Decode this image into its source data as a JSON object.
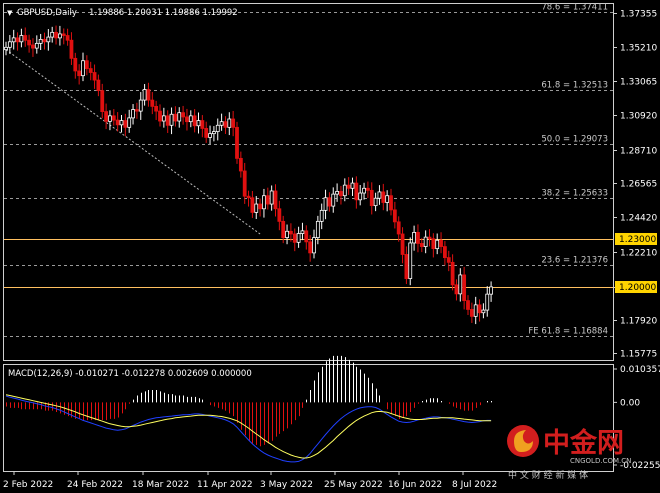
{
  "colors": {
    "background": "#000000",
    "bull_candle": "#ffffff",
    "bear_candle": "#e01010",
    "fib_line": "#9a9a9a",
    "level_line": "#ffc060",
    "level_badge": "#ffd400",
    "macd_hist_pos": "#ffffff",
    "macd_hist_neg": "#e01010",
    "macd_line": "#2040ff",
    "signal_line": "#ffff60",
    "trend_line": "#bdbdbd",
    "watermark_red": "#d21e1e",
    "watermark_orange": "#f0a020"
  },
  "header": {
    "arrow_glyph": "▼",
    "symbol": "GBPUSD,Daily",
    "ohlc": "1.19886 1.20031 1.19886 1.19992"
  },
  "macd_header": "MACD(12,26,9) -0.010271 -0.012278 0.002609 0.000000",
  "watermark": {
    "chinese": "中金网",
    "domain": "CNGOLD.COM.CN",
    "slogan": "中 文 财 经 新 媒 体"
  },
  "chart_data": {
    "type": "candlestick",
    "symbol": "GBPUSD",
    "timeframe": "Daily",
    "ylim": [
      1.1535,
      1.3795
    ],
    "xticks": [
      "2 Feb 2022",
      "24 Feb 2022",
      "18 Mar 2022",
      "11 Apr 2022",
      "3 May 2022",
      "25 May 2022",
      "16 Jun 2022",
      "8 Jul 2022"
    ],
    "price_ticks": [
      "1.37355",
      "1.35210",
      "1.33065",
      "1.30920",
      "1.28710",
      "1.26565",
      "1.24420",
      "1.22210",
      "1.20000",
      "1.17920",
      "1.15775"
    ],
    "fib_levels": [
      {
        "label": "78.6 = 1.37411",
        "value": 1.37411
      },
      {
        "label": "61.8 = 1.32513",
        "value": 1.32513
      },
      {
        "label": "50.0 = 1.29073",
        "value": 1.29073
      },
      {
        "label": "38.2 = 1.25633",
        "value": 1.25633
      },
      {
        "label": "23.6 = 1.21376",
        "value": 1.21376
      },
      {
        "label": "FE 61.8 = 1.16884",
        "value": 1.16884
      }
    ],
    "levels": [
      {
        "label": "1.23000",
        "value": 1.23
      },
      {
        "label": "1.20000",
        "value": 1.2
      }
    ],
    "trendline": {
      "from": {
        "date": "2 Feb 2022",
        "price": 1.3505
      },
      "to": {
        "date": "9 May 2022",
        "price": 1.2335
      }
    },
    "close": [
      1.352,
      1.3555,
      1.358,
      1.3555,
      1.3595,
      1.3565,
      1.3535,
      1.3515,
      1.3545,
      1.357,
      1.3555,
      1.3585,
      1.3615,
      1.358,
      1.3605,
      1.3595,
      1.3565,
      1.345,
      1.337,
      1.334,
      1.3435,
      1.3385,
      1.336,
      1.3312,
      1.3245,
      1.3112,
      1.305,
      1.3085,
      1.3058,
      1.3028,
      1.3055,
      1.3012,
      1.3072,
      1.3125,
      1.3115,
      1.3185,
      1.3252,
      1.3185,
      1.3145,
      1.3115,
      1.3052,
      1.3085,
      1.3025,
      1.3095,
      1.3052,
      1.3105,
      1.3078,
      1.3048,
      1.3085,
      1.3022,
      1.3055,
      1.3005,
      1.2948,
      1.2972,
      1.2985,
      1.3025,
      1.3048,
      1.3012,
      1.3065,
      1.3012,
      1.2815,
      1.2735,
      1.2575,
      1.2565,
      1.2472,
      1.2525,
      1.2495,
      1.2578,
      1.2525,
      1.2608,
      1.2495,
      1.2415,
      1.2312,
      1.2352,
      1.2335,
      1.2282,
      1.2338,
      1.2355,
      1.2285,
      1.2215,
      1.2312,
      1.2415,
      1.2485,
      1.2565,
      1.2512,
      1.2588,
      1.2605,
      1.2578,
      1.2645,
      1.2625,
      1.2658,
      1.2552,
      1.2595,
      1.2625,
      1.2612,
      1.2515,
      1.2562,
      1.2602,
      1.2535,
      1.2578,
      1.2488,
      1.2412,
      1.2335,
      1.2205,
      1.2052,
      1.2278,
      1.2345,
      1.2275,
      1.2255,
      1.2315,
      1.2305,
      1.2242,
      1.2295,
      1.2255,
      1.2185,
      1.2155,
      1.2012,
      1.1955,
      1.2075,
      1.1912,
      1.1856,
      1.1812,
      1.1885,
      1.1835,
      1.1852,
      1.1953,
      1.1999
    ],
    "macd": [
      0.0015,
      0.0012,
      0.001,
      0.0008,
      0.0005,
      0.0003,
      0.0001,
      -0.0001,
      -0.0003,
      -0.0005,
      -0.0008,
      -0.001,
      -0.0012,
      -0.0015,
      -0.0018,
      -0.0022,
      -0.0026,
      -0.003,
      -0.0034,
      -0.0038,
      -0.0042,
      -0.0045,
      -0.0048,
      -0.0051,
      -0.0054,
      -0.0057,
      -0.006,
      -0.0062,
      -0.0064,
      -0.0065,
      -0.0064,
      -0.0062,
      -0.0058,
      -0.0054,
      -0.005,
      -0.0046,
      -0.0043,
      -0.004,
      -0.0038,
      -0.0036,
      -0.0035,
      -0.0034,
      -0.0033,
      -0.0032,
      -0.0031,
      -0.003,
      -0.0029,
      -0.0029,
      -0.0028,
      -0.0027,
      -0.0027,
      -0.0028,
      -0.003,
      -0.0032,
      -0.0034,
      -0.0036,
      -0.0038,
      -0.0041,
      -0.0045,
      -0.005,
      -0.0058,
      -0.0068,
      -0.0078,
      -0.0088,
      -0.0097,
      -0.0105,
      -0.0112,
      -0.0118,
      -0.0123,
      -0.0127,
      -0.013,
      -0.0133,
      -0.0136,
      -0.0138,
      -0.0139,
      -0.0139,
      -0.0138,
      -0.0134,
      -0.0128,
      -0.0119,
      -0.0108,
      -0.0097,
      -0.0086,
      -0.0075,
      -0.0065,
      -0.0055,
      -0.0046,
      -0.0038,
      -0.0031,
      -0.0025,
      -0.002,
      -0.0016,
      -0.0013,
      -0.0011,
      -0.001,
      -0.001,
      -0.0012,
      -0.0016,
      -0.0022,
      -0.0028,
      -0.0034,
      -0.0039,
      -0.0044,
      -0.0046,
      -0.0047,
      -0.0046,
      -0.0044,
      -0.0041,
      -0.0039,
      -0.0037,
      -0.0035,
      -0.0034,
      -0.0034,
      -0.0035,
      -0.0036,
      -0.0037,
      -0.0039,
      -0.0041,
      -0.0043,
      -0.0045,
      -0.0046,
      -0.0047,
      -0.0046,
      -0.0045,
      -0.0043,
      -0.0042,
      -0.0042
    ],
    "signal": [
      0.0018,
      0.0016,
      0.0014,
      0.0012,
      0.001,
      0.0008,
      0.0006,
      0.0004,
      0.0002,
      0.0,
      -0.0002,
      -0.0004,
      -0.0006,
      -0.0008,
      -0.001,
      -0.0013,
      -0.0016,
      -0.0019,
      -0.0022,
      -0.0026,
      -0.0029,
      -0.0032,
      -0.0035,
      -0.0038,
      -0.0041,
      -0.0044,
      -0.0047,
      -0.005,
      -0.0052,
      -0.0054,
      -0.0056,
      -0.0057,
      -0.0057,
      -0.0056,
      -0.0055,
      -0.0053,
      -0.0051,
      -0.0049,
      -0.0047,
      -0.0045,
      -0.0043,
      -0.0041,
      -0.0039,
      -0.0038,
      -0.0036,
      -0.0035,
      -0.0034,
      -0.0033,
      -0.0032,
      -0.0031,
      -0.003,
      -0.003,
      -0.003,
      -0.003,
      -0.0031,
      -0.0032,
      -0.0033,
      -0.0035,
      -0.0037,
      -0.004,
      -0.0043,
      -0.0048,
      -0.0054,
      -0.006,
      -0.0067,
      -0.0074,
      -0.008,
      -0.0087,
      -0.0093,
      -0.0099,
      -0.0105,
      -0.011,
      -0.0115,
      -0.0119,
      -0.0123,
      -0.0126,
      -0.0128,
      -0.013,
      -0.013,
      -0.0128,
      -0.0124,
      -0.0119,
      -0.0112,
      -0.0105,
      -0.0097,
      -0.0089,
      -0.008,
      -0.0072,
      -0.0064,
      -0.0056,
      -0.0049,
      -0.0042,
      -0.0037,
      -0.0032,
      -0.0028,
      -0.0024,
      -0.0022,
      -0.0021,
      -0.0022,
      -0.0023,
      -0.0026,
      -0.0029,
      -0.0032,
      -0.0035,
      -0.0037,
      -0.0039,
      -0.004,
      -0.004,
      -0.004,
      -0.0039,
      -0.0038,
      -0.0037,
      -0.0037,
      -0.0036,
      -0.0036,
      -0.0036,
      -0.0036,
      -0.0037,
      -0.0038,
      -0.0039,
      -0.004,
      -0.0041,
      -0.0042,
      -0.0043,
      -0.0043,
      -0.0043,
      -0.0043
    ],
    "macd_ylim": [
      -0.0158,
      0.0085
    ],
    "macd_ticks": [
      "0.010357",
      "0.00",
      "-0.022557"
    ]
  }
}
